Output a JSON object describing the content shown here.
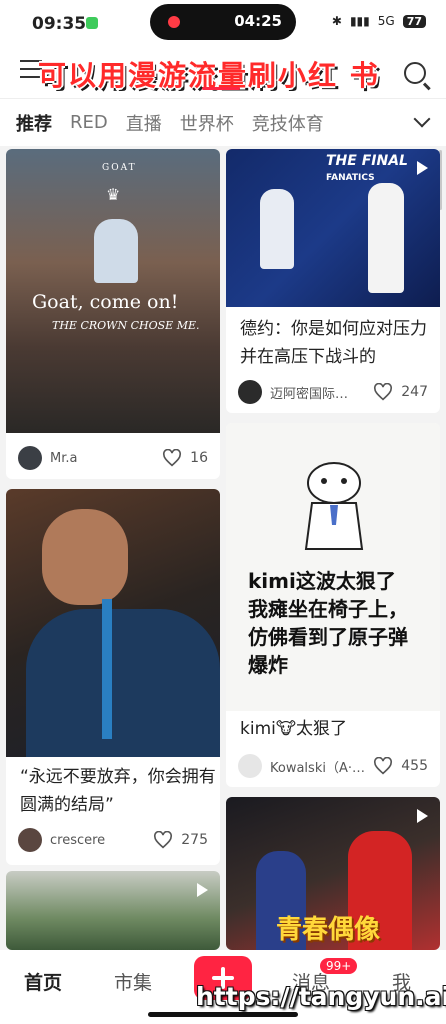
{
  "status_bar": {
    "time": "09:35",
    "recording_time": "04:25",
    "battery": "77",
    "signal": "5G"
  },
  "header": {
    "banner": "可以用漫游流量刷小红 书"
  },
  "tabs": [
    "推荐",
    "RED",
    "直播",
    "世界杯",
    "竞技体育"
  ],
  "feed": {
    "card1": {
      "overlay_top": "GOAT",
      "overlay_line1": "Goat,   come on!",
      "overlay_line2": "THE CROWN CHOSE ME.",
      "author": "Mr.a",
      "likes": "16"
    },
    "card2": {
      "video_banner": "THE FINAL",
      "video_sponsor": "FANATICS",
      "title": "德约：你是如何应对压力并在高压下战斗的",
      "author": "迈阿密国际…",
      "likes": "247"
    },
    "card3": {
      "title": "“永远不要放弃，你会拥有圆满的结局”",
      "author": "crescere",
      "likes": "275"
    },
    "card4": {
      "image_text": "kimi这波太狠了\n我瘫坐在椅子上，\n仿佛看到了原子弹\n爆炸",
      "title": "kimi🐮太狠了",
      "author": "Kowalski（A·…",
      "likes": "455"
    },
    "card6": {
      "overlay_text": "青春偶像"
    }
  },
  "bottom_nav": {
    "home": "首页",
    "market": "市集",
    "messages": "消息",
    "messages_badge": "99+",
    "me": "我"
  },
  "watermark": "https://tangyun.ai",
  "colors": {
    "brand_red": "#ff2442",
    "banner_red": "#ff2a2a"
  }
}
